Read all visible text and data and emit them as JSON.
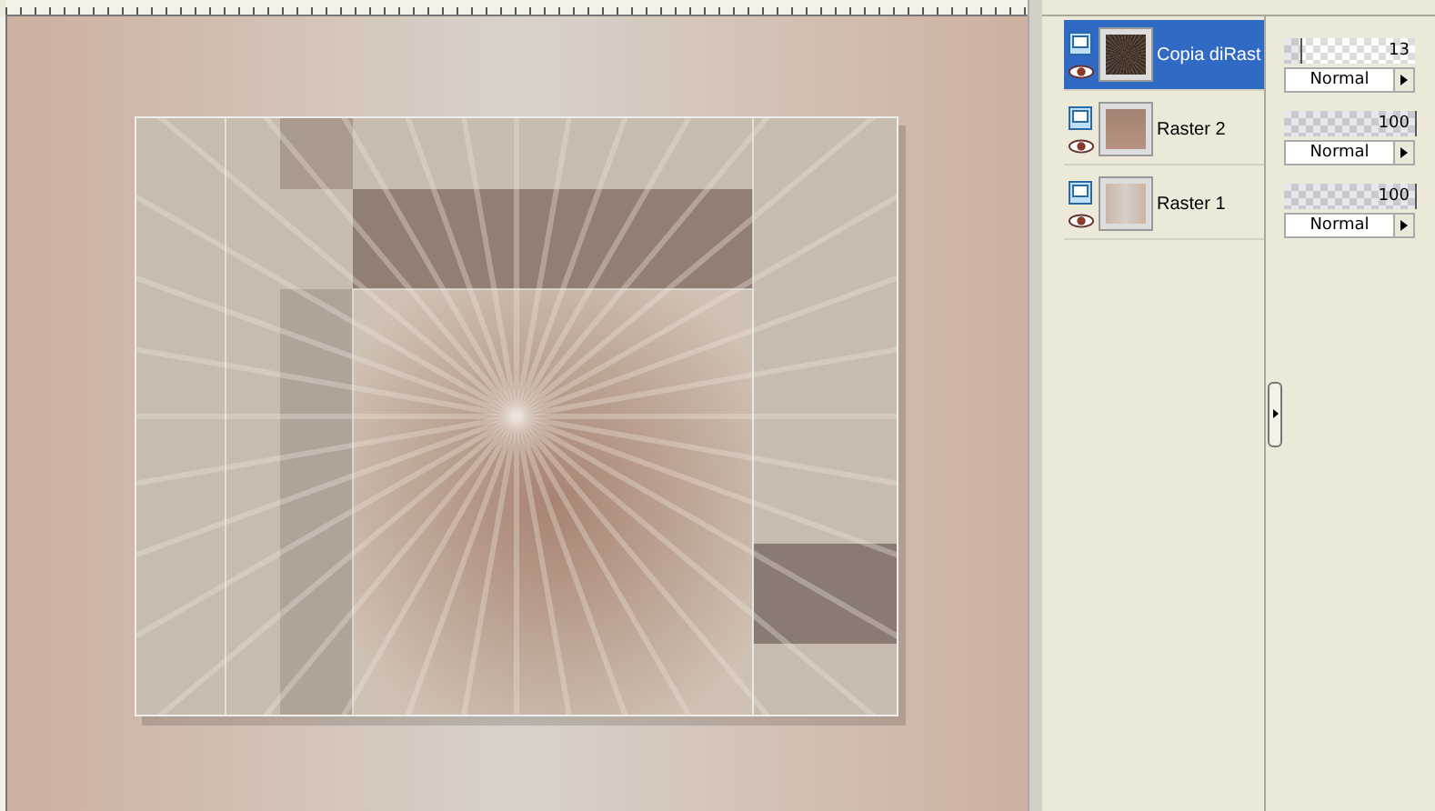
{
  "layers": [
    {
      "name": "Copia diRast",
      "selected": true,
      "opacity": "13",
      "level": 0.13,
      "blend": "Normal",
      "kind": "dark"
    },
    {
      "name": "Raster 2",
      "selected": false,
      "opacity": "100",
      "level": 1,
      "blend": "Normal",
      "kind": "frame"
    },
    {
      "name": "Raster 1",
      "selected": false,
      "opacity": "100",
      "level": 1,
      "blend": "Normal",
      "kind": "gradient"
    }
  ]
}
